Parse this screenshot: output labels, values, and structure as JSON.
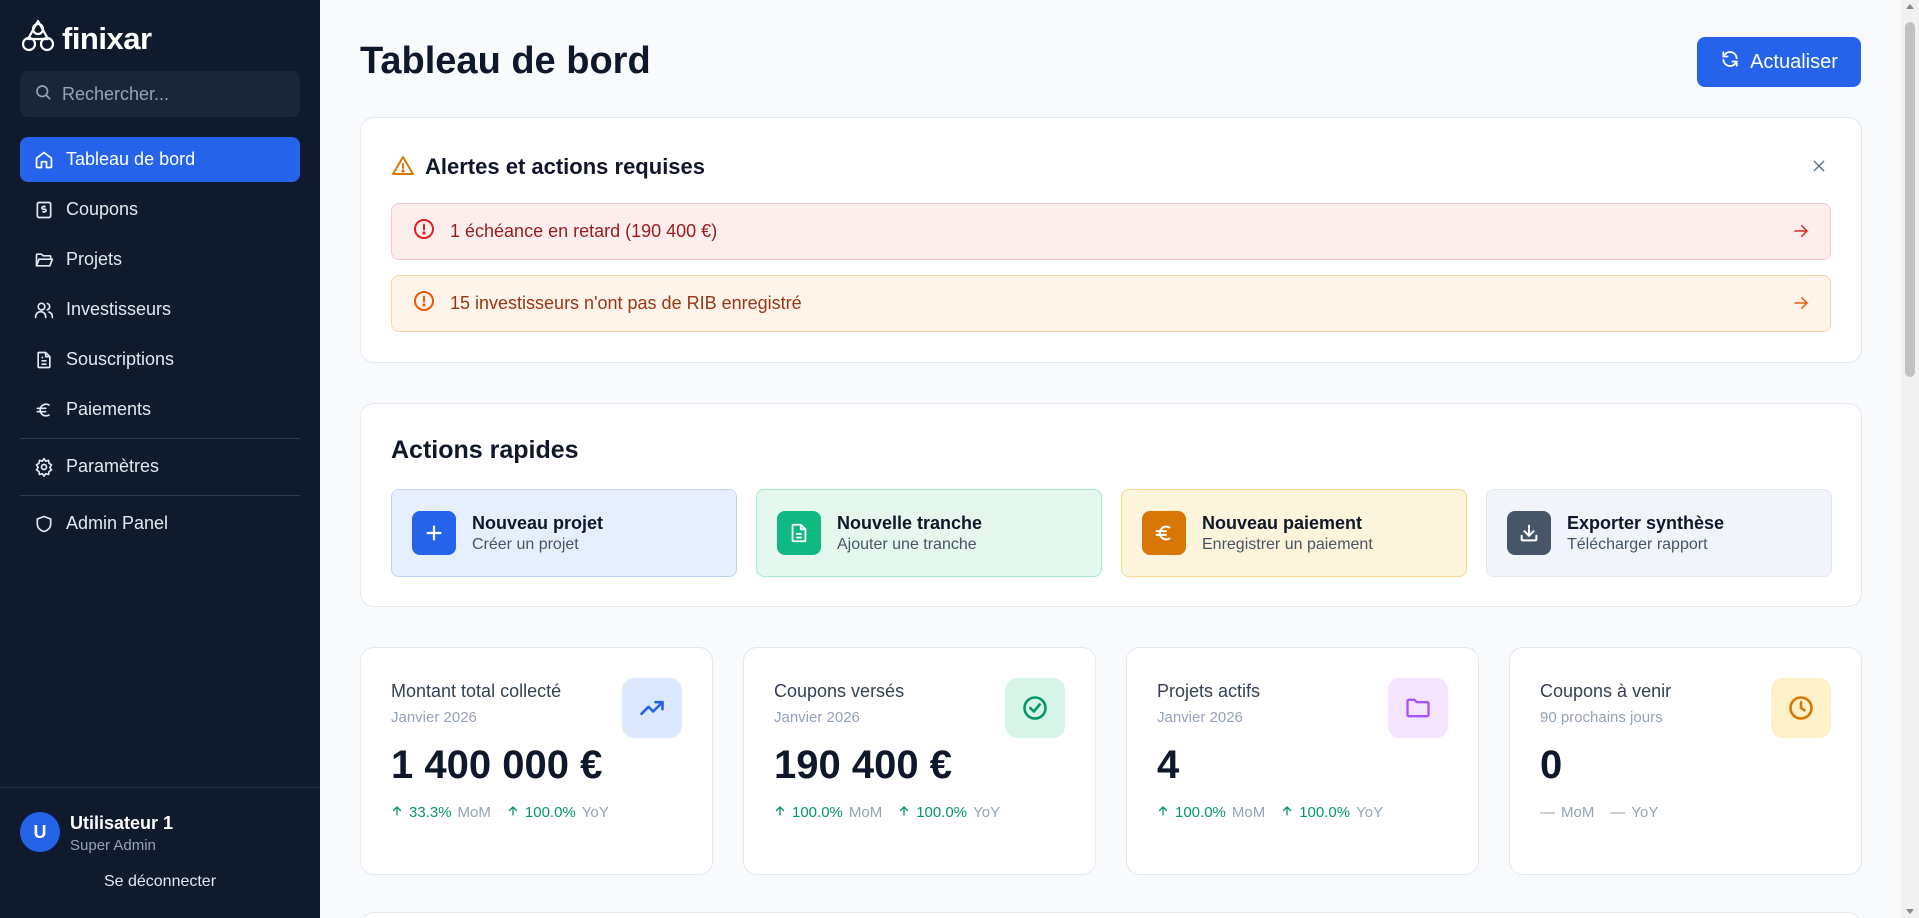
{
  "app": {
    "name": "finixar"
  },
  "sidebar": {
    "search_placeholder": "Rechercher...",
    "items": [
      {
        "label": "Tableau de bord",
        "icon": "home-icon",
        "active": true
      },
      {
        "label": "Coupons",
        "icon": "receipt-icon"
      },
      {
        "label": "Projets",
        "icon": "folder-icon"
      },
      {
        "label": "Investisseurs",
        "icon": "users-icon"
      },
      {
        "label": "Souscriptions",
        "icon": "document-icon"
      },
      {
        "label": "Paiements",
        "icon": "euro-icon"
      },
      {
        "label": "Paramètres",
        "icon": "gear-icon"
      },
      {
        "label": "Admin Panel",
        "icon": "shield-icon"
      }
    ],
    "user": {
      "initial": "U",
      "name": "Utilisateur 1",
      "role": "Super Admin",
      "logout": "Se déconnecter"
    }
  },
  "header": {
    "title": "Tableau de bord",
    "refresh_label": "Actualiser"
  },
  "alerts": {
    "title": "Alertes et actions requises",
    "items": [
      {
        "text": "1 échéance en retard (190 400 €)",
        "severity": "red"
      },
      {
        "text": "15 investisseurs n'ont pas de RIB enregistré",
        "severity": "orange"
      }
    ]
  },
  "quick_actions": {
    "title": "Actions rapides",
    "items": [
      {
        "title": "Nouveau projet",
        "subtitle": "Créer un projet",
        "icon": "plus-icon",
        "color": "#2563eb"
      },
      {
        "title": "Nouvelle tranche",
        "subtitle": "Ajouter une tranche",
        "icon": "document-icon",
        "color": "#10b981"
      },
      {
        "title": "Nouveau paiement",
        "subtitle": "Enregistrer un paiement",
        "icon": "euro-icon",
        "color": "#d97706"
      },
      {
        "title": "Exporter synthèse",
        "subtitle": "Télécharger rapport",
        "icon": "download-icon",
        "color": "#475569"
      }
    ]
  },
  "stats": [
    {
      "label": "Montant total collecté",
      "period": "Janvier 2026",
      "value": "1 400 000 €",
      "mom": "33.3%",
      "yoy": "100.0%",
      "mom_label": "MoM",
      "yoy_label": "YoY",
      "icon": "trending-up-icon"
    },
    {
      "label": "Coupons versés",
      "period": "Janvier 2026",
      "value": "190 400 €",
      "mom": "100.0%",
      "yoy": "100.0%",
      "mom_label": "MoM",
      "yoy_label": "YoY",
      "icon": "check-circle-icon"
    },
    {
      "label": "Projets actifs",
      "period": "Janvier 2026",
      "value": "4",
      "mom": "100.0%",
      "yoy": "100.0%",
      "mom_label": "MoM",
      "yoy_label": "YoY",
      "icon": "folder-icon"
    },
    {
      "label": "Coupons à venir",
      "period": "90 prochains jours",
      "value": "0",
      "mom": "—",
      "yoy": "—",
      "mom_label": "MoM",
      "yoy_label": "YoY",
      "icon": "clock-icon"
    }
  ],
  "colors": {
    "accent": "#2563eb",
    "sidebar_bg": "#0f1b2d",
    "positive": "#059669"
  }
}
